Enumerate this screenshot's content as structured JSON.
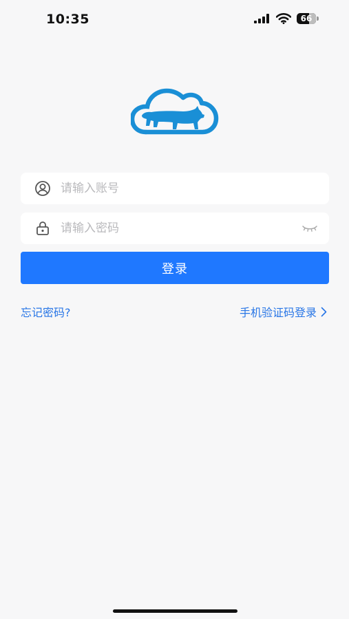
{
  "status_bar": {
    "time": "10:35",
    "battery": "66",
    "battery_level": 0.66,
    "icons": [
      "signal-icon",
      "wifi-icon",
      "battery-icon"
    ]
  },
  "logo": {
    "icon": "cloud-pig-logo",
    "color": "#1a8fd6"
  },
  "form": {
    "account": {
      "value": "",
      "placeholder": "请输入账号",
      "icon": "user-icon"
    },
    "password": {
      "value": "",
      "placeholder": "请输入密码",
      "icon": "lock-icon",
      "toggle_icon": "eye-closed-icon"
    },
    "login_label": "登录"
  },
  "links": {
    "forgot_password": "忘记密码?",
    "sms_login": "手机验证码登录",
    "sms_login_icon": "chevron-right-icon"
  },
  "colors": {
    "primary": "#1f78ff",
    "link": "#2775e6",
    "background": "#f7f7f8",
    "placeholder": "#b9b9bc"
  }
}
